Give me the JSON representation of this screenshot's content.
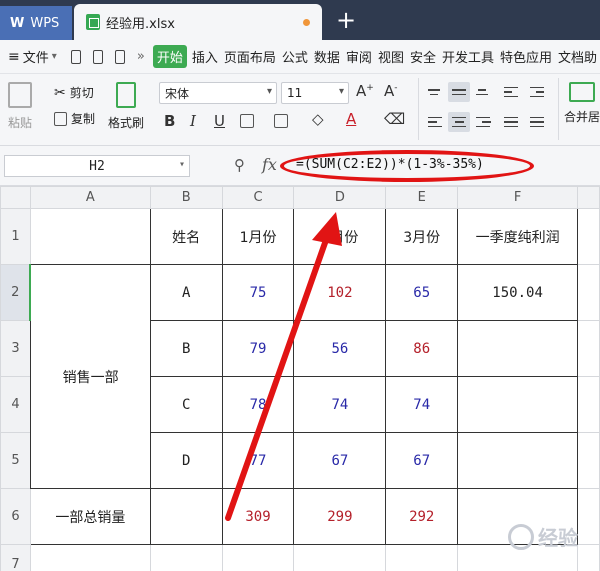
{
  "titlebar": {
    "app_tab": "WPS",
    "file_tab": "经验用.xlsx",
    "new_tab_icon": "plus-icon"
  },
  "menubar": {
    "file_label": "文件",
    "items": [
      "开始",
      "插入",
      "页面布局",
      "公式",
      "数据",
      "审阅",
      "视图",
      "安全",
      "开发工具",
      "特色应用",
      "文档助"
    ]
  },
  "ribbon": {
    "paste": "粘贴",
    "cut": "剪切",
    "copy": "复制",
    "format_painter": "格式刷",
    "font_name": "宋体",
    "font_size": "11",
    "bold": "B",
    "italic": "I",
    "underline": "U",
    "merge": "合并居"
  },
  "formula_bar": {
    "cell_ref": "H2",
    "fx": "fx",
    "formula": "=(SUM(C2:E2))*(1-3%-35%)"
  },
  "grid": {
    "columns": [
      "A",
      "B",
      "C",
      "D",
      "E",
      "F"
    ],
    "rows": [
      "1",
      "2",
      "3",
      "4",
      "5",
      "6",
      "7"
    ],
    "header": {
      "name": "姓名",
      "m1": "1月份",
      "m2": "2月份",
      "m3": "3月份",
      "profit": "一季度纯利润"
    },
    "dept": "销售一部",
    "data": [
      {
        "name": "A",
        "c": "75",
        "d": "102",
        "e": "65",
        "f": "150.04"
      },
      {
        "name": "B",
        "c": "79",
        "d": "56",
        "e": "86",
        "f": ""
      },
      {
        "name": "C",
        "c": "78",
        "d": "74",
        "e": "74",
        "f": ""
      },
      {
        "name": "D",
        "c": "77",
        "d": "67",
        "e": "67",
        "f": ""
      }
    ],
    "total": {
      "label": "一部总销量",
      "c": "309",
      "d": "299",
      "e": "292"
    }
  },
  "colors": {
    "annotation": "#e11414",
    "accent": "#3daa52"
  },
  "watermark": "经验"
}
